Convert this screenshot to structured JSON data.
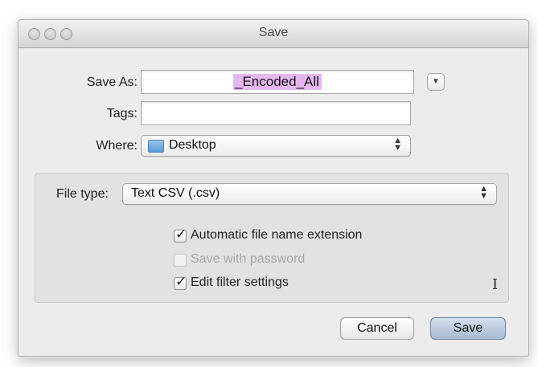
{
  "window": {
    "title": "Save",
    "controls": [
      "close",
      "minimize",
      "zoom"
    ]
  },
  "form": {
    "save_as_label": "Save As:",
    "save_as_value": "_Encoded_All",
    "tags_label": "Tags:",
    "tags_value": "",
    "where_label": "Where:",
    "where_value": "Desktop",
    "where_icon": "folder-icon"
  },
  "options": {
    "file_type_label": "File type:",
    "file_type_value": "Text CSV (.csv)",
    "checkboxes": [
      {
        "label": "Automatic file name extension",
        "checked": true,
        "enabled": true
      },
      {
        "label": "Save with password",
        "checked": false,
        "enabled": false
      },
      {
        "label": "Edit filter settings",
        "checked": true,
        "enabled": true
      }
    ]
  },
  "buttons": {
    "cancel": "Cancel",
    "save": "Save"
  },
  "colors": {
    "selection_highlight": "#e6b7f0",
    "default_button": "#a7bbd3"
  }
}
